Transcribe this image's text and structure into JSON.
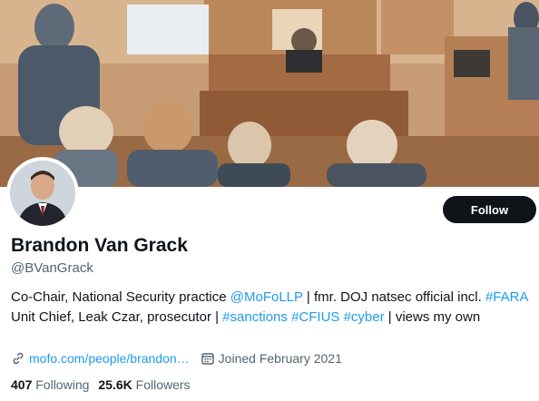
{
  "profile": {
    "name": "Brandon Van Grack",
    "handle": "@BVanGrack",
    "follow_label": "Follow",
    "bio": {
      "t1": "Co-Chair, National Security practice ",
      "mention": "@MoFoLLP",
      "t2": " | fmr. DOJ natsec official incl. ",
      "tag1": "#FARA",
      "t3": " Unit Chief, Leak Czar, prosecutor | ",
      "tag2": "#sanctions",
      "t4": " ",
      "tag3": "#CFIUS",
      "t5": " ",
      "tag4": "#cyber",
      "t6": " | views my own"
    },
    "website": "mofo.com/people/brandon…",
    "joined": "Joined February 2021",
    "following_count": "407",
    "following_label": "Following",
    "followers_count": "25.6K",
    "followers_label": "Followers"
  },
  "colors": {
    "link": "#1d9bf0",
    "button_bg": "#0f1419",
    "secondary_text": "#536471"
  },
  "icons": [
    "link-icon",
    "calendar-icon"
  ]
}
